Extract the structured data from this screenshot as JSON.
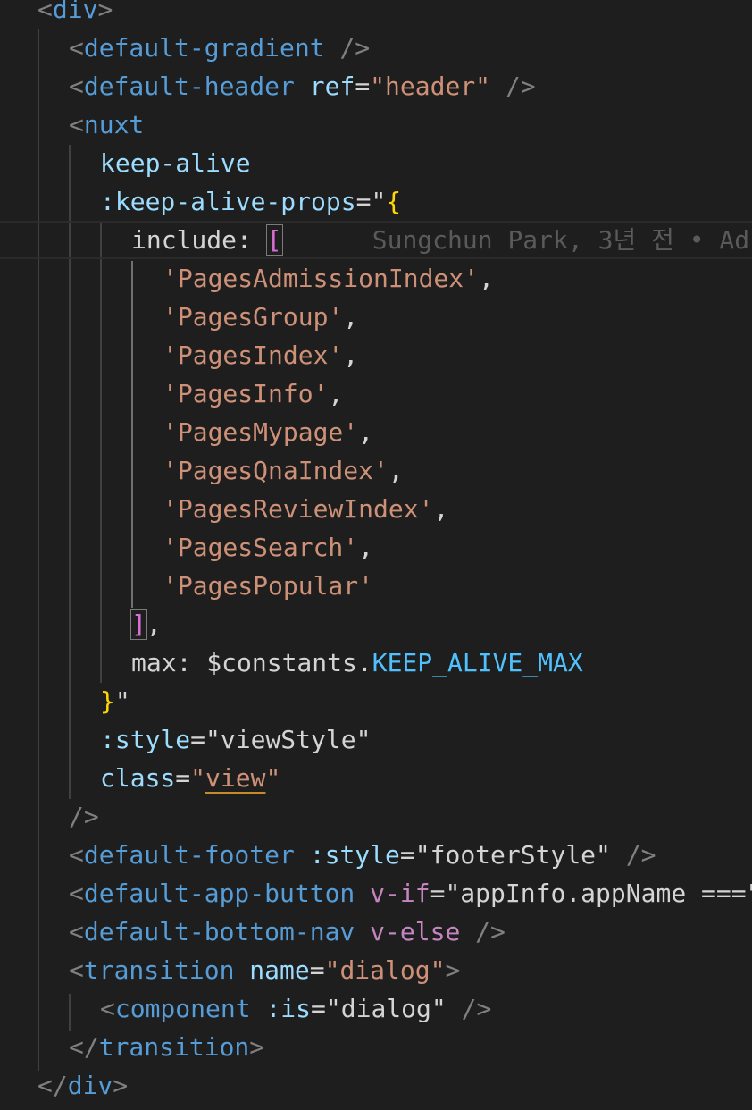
{
  "editor": {
    "l00": [
      "<",
      "div",
      ">"
    ],
    "l01": [
      "<",
      "default-gradient",
      " />"
    ],
    "l02": [
      "<",
      "default-header",
      " ",
      "ref",
      "=",
      "\"header\"",
      " />"
    ],
    "l03": [
      "<",
      "nuxt"
    ],
    "l04": [
      "keep-alive"
    ],
    "l05": [
      ":keep-alive-props",
      "=",
      "\"",
      "{"
    ],
    "l06": [
      "include: ",
      "[",
      "Sungchun Park, 3년 전 • Ad"
    ],
    "l07": [
      "'PagesAdmissionIndex'",
      ","
    ],
    "l08": [
      "'PagesGroup'",
      ","
    ],
    "l09": [
      "'PagesIndex'",
      ","
    ],
    "l10": [
      "'PagesInfo'",
      ","
    ],
    "l11": [
      "'PagesMypage'",
      ","
    ],
    "l12": [
      "'PagesQnaIndex'",
      ","
    ],
    "l13": [
      "'PagesReviewIndex'",
      ","
    ],
    "l14": [
      "'PagesSearch'",
      ","
    ],
    "l15": [
      "'PagesPopular'"
    ],
    "l16": [
      "]",
      ","
    ],
    "l17": [
      "max: $constants.",
      "KEEP_ALIVE_MAX"
    ],
    "l18": [
      "}",
      "\""
    ],
    "l19": [
      ":style",
      "=",
      "\"viewStyle\""
    ],
    "l20": [
      "class",
      "=",
      "\"",
      "view",
      "\""
    ],
    "l21": [
      "/>"
    ],
    "l22": [
      "<",
      "default-footer",
      " ",
      ":style",
      "=",
      "\"footerStyle\"",
      " />"
    ],
    "l23": [
      "<",
      "default-app-button",
      " ",
      "v-if",
      "=",
      "\"appInfo.appName ===\""
    ],
    "l24": [
      "<",
      "default-bottom-nav",
      " ",
      "v-else",
      " />"
    ],
    "l25": [
      "<",
      "transition",
      " ",
      "name",
      "=",
      "\"dialog\"",
      ">"
    ],
    "l26": [
      "<",
      "component",
      " ",
      ":is",
      "=",
      "\"dialog\"",
      " />"
    ],
    "l27": [
      "</",
      "transition",
      ">"
    ],
    "l28": [
      "</",
      "div",
      ">"
    ]
  }
}
